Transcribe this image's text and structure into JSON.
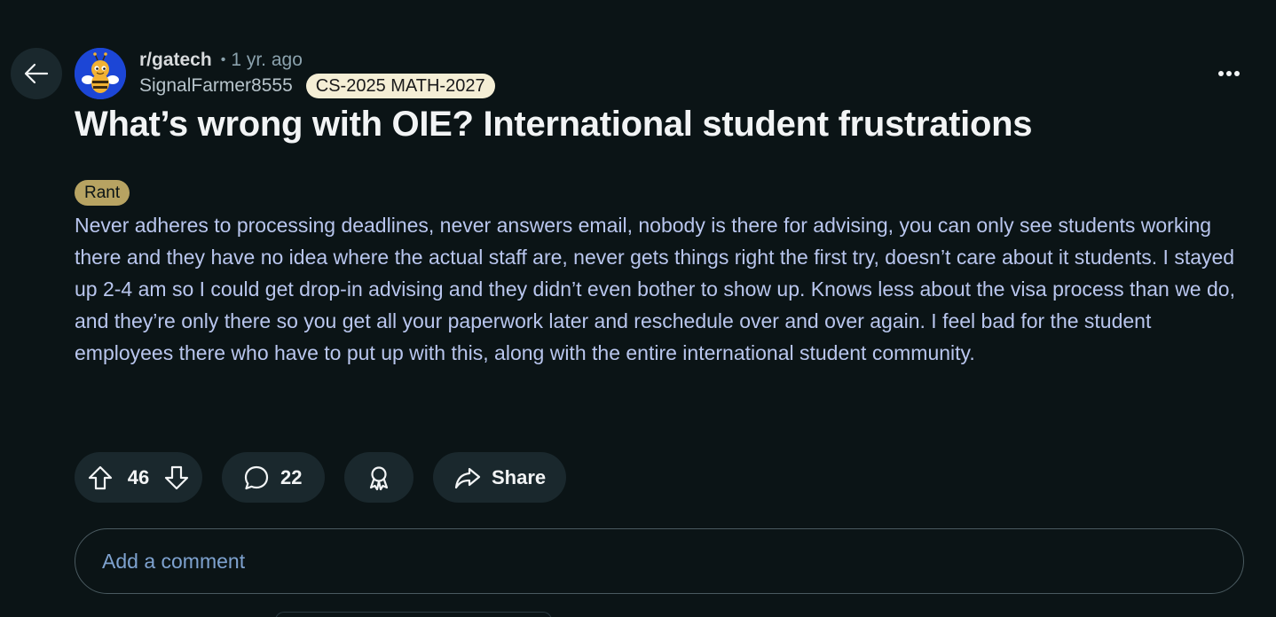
{
  "header": {
    "subreddit": "r/gatech",
    "separator": "•",
    "age": "1 yr. ago",
    "username": "SignalFarmer8555",
    "user_flair": "CS-2025 MATH-2027"
  },
  "post": {
    "title": "What’s wrong with OIE? International student frustrations",
    "flair": "Rant",
    "body": "Never adheres to processing deadlines, never answers email, nobody is there for advising, you can only see students working there and they have no idea where the actual staff are, never gets things right the first try, doesn’t care about it students. I stayed up 2-4 am so I could get drop-in advising and they didn’t even bother to show up. Knows less about the visa process than we do, and they’re only there so you get all your paperwork later and reschedule over and over again. I feel bad for the student employees there who have to put up with this, along with the entire international student community."
  },
  "actions": {
    "vote_count": "46",
    "comment_count": "22",
    "share_label": "Share"
  },
  "comment_box": {
    "placeholder": "Add a comment"
  },
  "icons": {
    "back": "arrow-left-icon",
    "more": "more-horizontal-icon",
    "upvote": "arrow-up-icon",
    "downvote": "arrow-down-icon",
    "comment": "speech-bubble-icon",
    "award": "award-ribbon-icon",
    "share": "share-arrow-icon"
  },
  "colors": {
    "background": "#0b1416",
    "pill": "#1a282d",
    "body_text": "#b9c6ee",
    "flair_rant": "#b7a362",
    "avatar_bg": "#1c46d6",
    "placeholder": "#7ea2cf"
  }
}
